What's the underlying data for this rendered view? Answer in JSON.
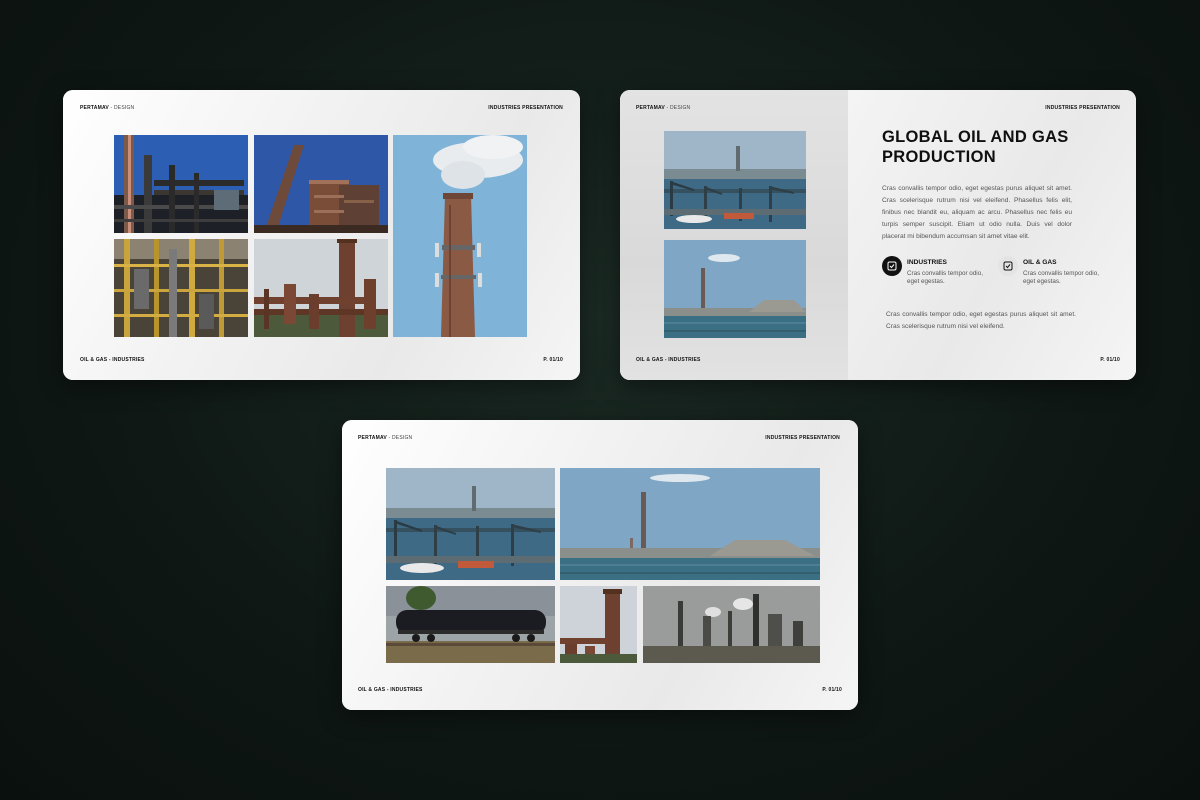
{
  "slides": [
    {
      "brand_bold": "PERTAMAV",
      "brand_light": "- DESIGN",
      "header_right": "INDUSTRIES PRESENTATION",
      "footer_left": "OIL & GAS - INDUSTRIES",
      "footer_right": "P. 01/10",
      "photos": [
        "refinery-pipes-photo",
        "tall-tanks-photo",
        "smokestack-photo",
        "scaffold-refinery-photo",
        "rusty-refinery-photo"
      ]
    },
    {
      "brand_bold": "PERTAMAV",
      "brand_light": "- DESIGN",
      "header_right": "INDUSTRIES PRESENTATION",
      "footer_left": "OIL & GAS - INDUSTRIES",
      "footer_right": "P. 01/10",
      "title": "GLOBAL OIL AND GAS PRODUCTION",
      "paragraph": "Cras convallis tempor odio, eget egestas purus aliquet sit amet. Cras scelerisque rutrum nisi vel eleifend. Phasellus felis elit, finibus nec blandit eu, aliquam ac arcu. Phasellus nec felis eu turpis semper suscipit. Etiam ut odio nulla. Duis vel dolor placerat mi bibendum accumsan sit amet vitae elit.",
      "features": [
        {
          "label": "INDUSTRIES",
          "desc": "Cras convallis tempor odio, eget egestas.",
          "icon": "check-square-icon"
        },
        {
          "label": "OIL & GAS",
          "desc": "Cras convallis tempor odio, eget egestas.",
          "icon": "check-square-icon"
        }
      ],
      "paragraph2": "Cras convallis tempor odio, eget egestas purus aliquet sit amet. Cras scelerisque rutrum nisi vel eleifend."
    },
    {
      "brand_bold": "PERTAMAV",
      "brand_light": "- DESIGN",
      "header_right": "INDUSTRIES PRESENTATION",
      "footer_left": "OIL & GAS - INDUSTRIES",
      "footer_right": "P. 01/10"
    }
  ],
  "colors": {
    "background": "#0f1815",
    "slide": "#f6f6f6",
    "text": "#111111",
    "accent_dark": "#111111"
  }
}
